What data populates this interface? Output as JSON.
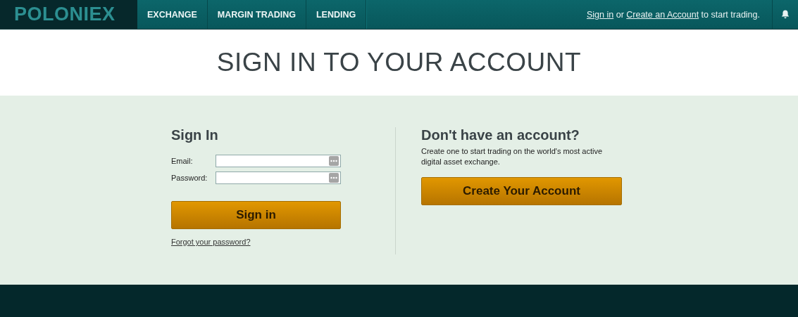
{
  "header": {
    "logo": "POLONIEX",
    "nav": [
      {
        "label": "EXCHANGE",
        "selected": false
      },
      {
        "label": "MARGIN TRADING",
        "selected": false
      },
      {
        "label": "LENDING",
        "selected": false
      }
    ],
    "account_prompt": {
      "sign_in_link": "Sign in",
      "joiner": "or",
      "create_link": "Create an Account",
      "suffix": "to start trading."
    }
  },
  "page_title": "SIGN IN TO YOUR ACCOUNT",
  "sign_in": {
    "heading": "Sign In",
    "fields": [
      {
        "label": "Email:"
      },
      {
        "label": "Password:"
      }
    ],
    "button": "Sign in",
    "forgot_link": "Forgot your password?"
  },
  "register": {
    "heading": "Don't have an account?",
    "text": "Create one to start trading on the world's most active digital asset exchange.",
    "button": "Create Your Account"
  }
}
